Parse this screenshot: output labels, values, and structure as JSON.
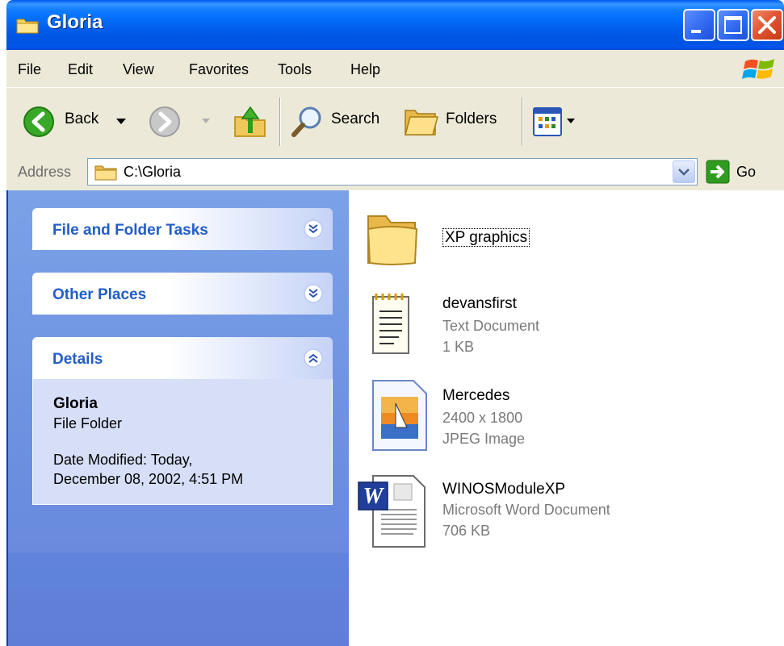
{
  "window": {
    "title": "Gloria"
  },
  "menubar": {
    "items": [
      "File",
      "Edit",
      "View",
      "Favorites",
      "Tools",
      "Help"
    ]
  },
  "toolbar": {
    "back_label": "Back",
    "search_label": "Search",
    "folders_label": "Folders"
  },
  "address": {
    "label": "Address",
    "value": "C:\\Gloria",
    "go_label": "Go"
  },
  "tasks": {
    "file_folder_tasks": "File and Folder Tasks",
    "other_places": "Other Places",
    "details": {
      "title": "Details",
      "name": "Gloria",
      "type": "File Folder",
      "date_line1": "Date Modified: Today,",
      "date_line2": "December 08, 2002, 4:51 PM"
    }
  },
  "files": [
    {
      "name": "XP graphics",
      "kind": "folder-icon"
    },
    {
      "name": "devansfirst",
      "line2": "Text Document",
      "line3": "1 KB",
      "kind": "text-document-icon"
    },
    {
      "name": "Mercedes",
      "line2": "2400 x 1800",
      "line3": "JPEG Image",
      "kind": "jpeg-image-icon"
    },
    {
      "name": "WINOSModuleXP",
      "line2": "Microsoft Word Document",
      "line3": "706 KB",
      "kind": "word-document-icon"
    }
  ],
  "colors": {
    "titlebar": "#0054e3",
    "panel_title": "#215dc6",
    "left_pane": "#6d90e0",
    "chrome": "#ece9d8"
  }
}
